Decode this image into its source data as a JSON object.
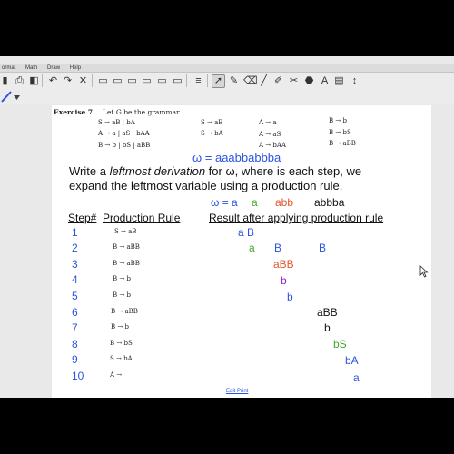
{
  "menu": [
    "ormat",
    "Math",
    "Draw",
    "Help"
  ],
  "toolbar": {
    "icons": [
      "▮",
      "⎙",
      "◧",
      "↶",
      "↷",
      "✕",
      "▭",
      "▭",
      "▭",
      "▭",
      "▭",
      "▭",
      "≡",
      "➚",
      "✎",
      "⌫",
      "╱",
      "✐",
      "✂",
      "⬣",
      "A",
      "▤",
      "↕"
    ]
  },
  "exercise": {
    "title": "Exercise 7.",
    "intro": "Let G be the grammar",
    "rules": [
      "S → aB | bA",
      "A → a | aS | bAA",
      "B → b | bS | aBB",
      "S → aB",
      "S → bA",
      "A → a",
      "A → aS",
      "A → bAA",
      "B → b",
      "B → bS",
      "B → aBB"
    ]
  },
  "omega": "ω = aaabbabbba",
  "instructions": {
    "pre": "Write a ",
    "em": "leftmost derivation",
    "post": " for ω, where is each step, we",
    "line2": "expand the leftmost variable using a production rule."
  },
  "omega_split": {
    "prefix": "ω = a",
    "p1": "a",
    "p2": "abb",
    "p3": "abbba"
  },
  "headers": {
    "step": "Step#",
    "rule": "Production Rule",
    "result": "Result after applying production rule"
  },
  "steps": [
    {
      "n": "1",
      "rule": "S → aB"
    },
    {
      "n": "2",
      "rule": "B → aBB"
    },
    {
      "n": "3",
      "rule": "B → aBB"
    },
    {
      "n": "4",
      "rule": "B → b"
    },
    {
      "n": "5",
      "rule": "B → b"
    },
    {
      "n": "6",
      "rule": "B → aBB"
    },
    {
      "n": "7",
      "rule": "B → b"
    },
    {
      "n": "8",
      "rule": "B → bS"
    },
    {
      "n": "9",
      "rule": "S → bA"
    },
    {
      "n": "10",
      "rule": "A →"
    }
  ],
  "results": [
    {
      "text": "a B",
      "color": "#2b54e0"
    },
    {
      "text": "a",
      "color": "#45a62e"
    },
    {
      "text": "B",
      "color": "#2b54e0"
    },
    {
      "text": "B",
      "color": "#2b54e0"
    },
    {
      "text": "aBB",
      "color": "#e2552a"
    },
    {
      "text": "b",
      "color": "#8a1ed0"
    },
    {
      "text": "b",
      "color": "#2b54e0"
    },
    {
      "text": "aBB",
      "color": "#111111"
    },
    {
      "text": "b",
      "color": "#111111"
    },
    {
      "text": "bS",
      "color": "#45a62e"
    },
    {
      "text": "bA",
      "color": "#2b54e0"
    },
    {
      "text": "a",
      "color": "#2b54e0"
    }
  ],
  "link": "Edit Print"
}
